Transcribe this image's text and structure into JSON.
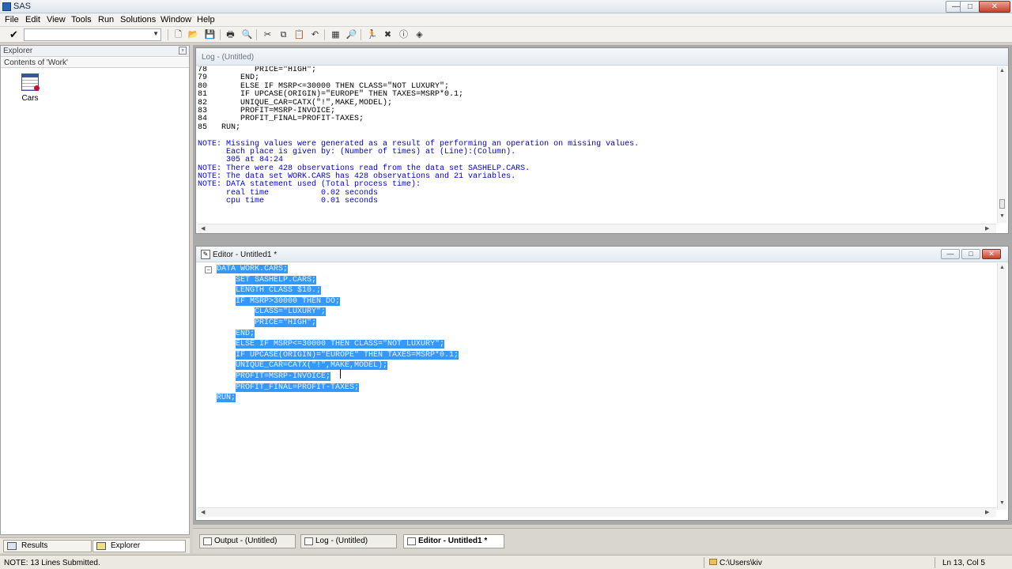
{
  "window": {
    "title": "SAS",
    "min_glyph": "—",
    "max_glyph": "□",
    "close_glyph": "✕"
  },
  "menu": [
    "File",
    "Edit",
    "View",
    "Tools",
    "Run",
    "Solutions",
    "Window",
    "Help"
  ],
  "toolbar": {
    "command_value": "",
    "icons": [
      "new-icon",
      "open-icon",
      "save-icon",
      "print-icon",
      "print-preview-icon",
      "cut-icon",
      "copy-icon",
      "paste-icon",
      "undo-icon",
      "libraries-icon",
      "explorer-icon",
      "submit-icon",
      "break-icon",
      "clear-icon",
      "help-icon",
      "sas-icon"
    ]
  },
  "explorer": {
    "title": "Explorer",
    "contents_label": "Contents of 'Work'",
    "items": [
      {
        "label": "Cars",
        "icon": "dataset-icon"
      }
    ]
  },
  "left_tabs": [
    {
      "label": "Results",
      "icon": "results-icon"
    },
    {
      "label": "Explorer",
      "icon": "explorer-icon"
    }
  ],
  "log": {
    "title": "Log - (Untitled)",
    "lines": [
      {
        "kind": "code",
        "text": "78          PRICE=\"HIGH\";"
      },
      {
        "kind": "code",
        "text": "79       END;"
      },
      {
        "kind": "code",
        "text": "80       ELSE IF MSRP<=30000 THEN CLASS=\"NOT LUXURY\";"
      },
      {
        "kind": "code",
        "text": "81       IF UPCASE(ORIGIN)=\"EUROPE\" THEN TAXES=MSRP*0.1;"
      },
      {
        "kind": "code",
        "text": "82       UNIQUE_CAR=CATX(\"!\",MAKE,MODEL);"
      },
      {
        "kind": "code",
        "text": "83       PROFIT=MSRP-INVOICE;"
      },
      {
        "kind": "code",
        "text": "84       PROFIT_FINAL=PROFIT-TAXES;"
      },
      {
        "kind": "code",
        "text": "85   RUN;"
      },
      {
        "kind": "blank",
        "text": ""
      },
      {
        "kind": "note",
        "text": "NOTE: Missing values were generated as a result of performing an operation on missing values."
      },
      {
        "kind": "note",
        "text": "      Each place is given by: (Number of times) at (Line):(Column)."
      },
      {
        "kind": "note",
        "text": "      305 at 84:24"
      },
      {
        "kind": "note",
        "text": "NOTE: There were 428 observations read from the data set SASHELP.CARS."
      },
      {
        "kind": "note",
        "text": "NOTE: The data set WORK.CARS has 428 observations and 21 variables."
      },
      {
        "kind": "note",
        "text": "NOTE: DATA statement used (Total process time):"
      },
      {
        "kind": "note",
        "text": "      real time           0.02 seconds"
      },
      {
        "kind": "note",
        "text": "      cpu time            0.01 seconds"
      }
    ]
  },
  "editor": {
    "title": "Editor - Untitled1 *",
    "collapse_glyph": "−",
    "lines": [
      {
        "indent": "",
        "text": "DATA WORK.CARS;"
      },
      {
        "indent": "    ",
        "text": "SET SASHELP.CARS;"
      },
      {
        "indent": "    ",
        "text": "LENGTH CLASS $10.;"
      },
      {
        "indent": "    ",
        "text": "IF MSRP>30000 THEN DO;"
      },
      {
        "indent": "        ",
        "text": "CLASS=\"LUXURY\";"
      },
      {
        "indent": "        ",
        "text": "PRICE=\"HIGH\";"
      },
      {
        "indent": "    ",
        "text": "END;"
      },
      {
        "indent": "    ",
        "text": "ELSE IF MSRP<=30000 THEN CLASS=\"NOT LUXURY\";"
      },
      {
        "indent": "    ",
        "text": "IF UPCASE(ORIGIN)=\"EUROPE\" THEN TAXES=MSRP*0.1;"
      },
      {
        "indent": "    ",
        "text": "UNIQUE_CAR=CATX(\"!\",MAKE,MODEL);"
      },
      {
        "indent": "    ",
        "text": "PROFIT=MSRP-INVOICE;"
      },
      {
        "indent": "    ",
        "text": "PROFIT_FINAL=PROFIT-TAXES;"
      },
      {
        "indent": "",
        "text": "RUN;"
      }
    ]
  },
  "window_tabs": [
    {
      "label": "Output - (Untitled)",
      "active": false
    },
    {
      "label": "Log - (Untitled)",
      "active": false
    },
    {
      "label": "Editor - Untitled1 *",
      "active": true
    }
  ],
  "status": {
    "message": "NOTE: 13 Lines Submitted.",
    "path": "C:\\Users\\kiv",
    "position": "Ln 13, Col 5"
  },
  "colors": {
    "selection": "#3399ff",
    "note_text": "#0000d0"
  }
}
